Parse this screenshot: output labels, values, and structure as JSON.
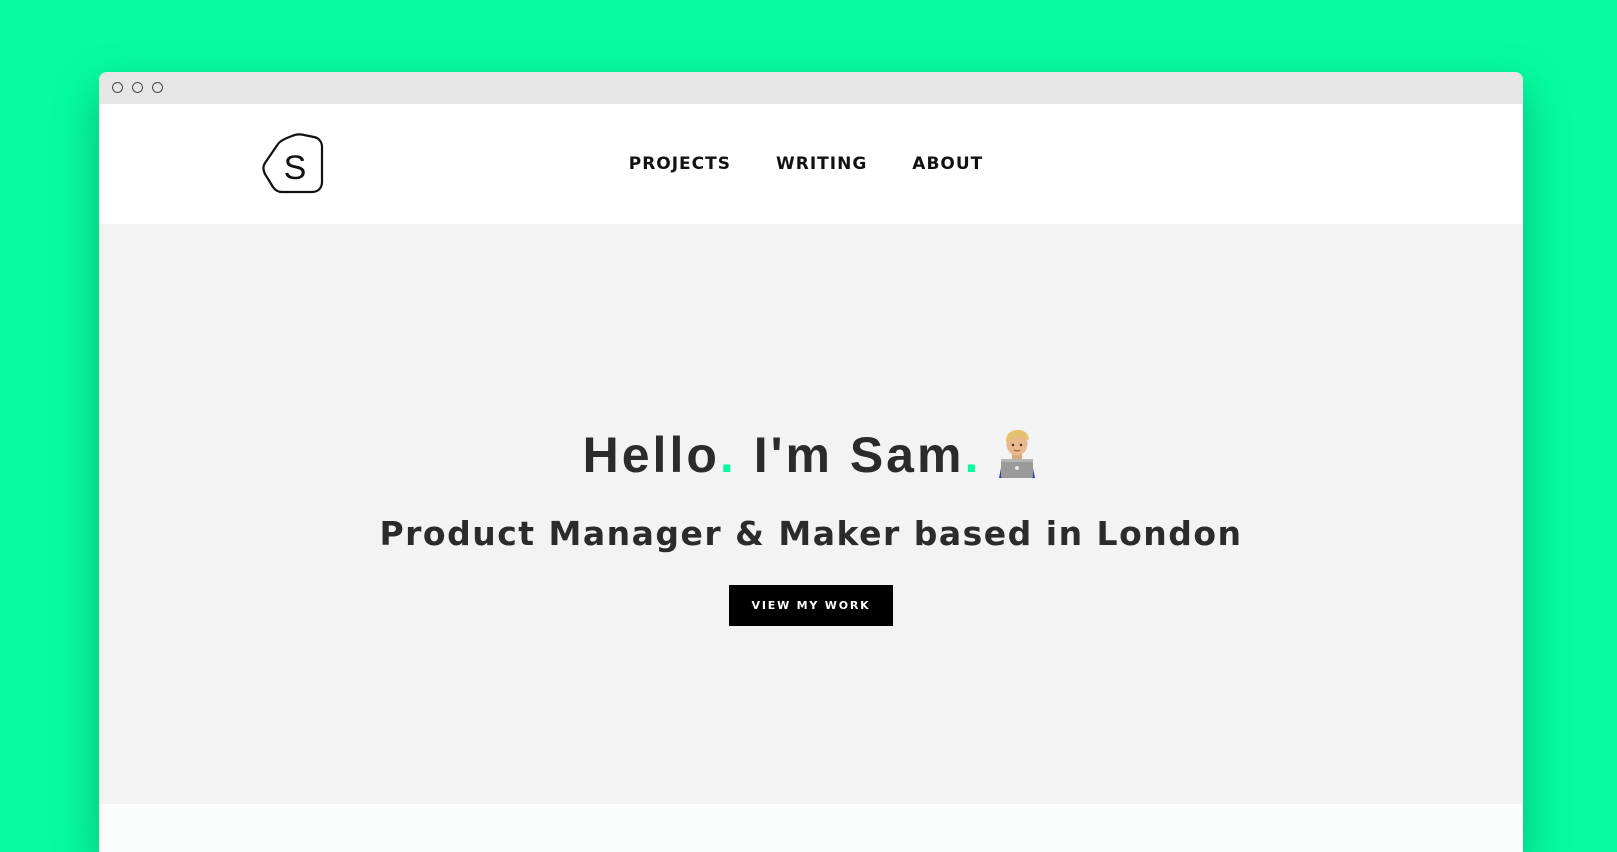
{
  "colors": {
    "background": "#06fca0",
    "accent": "#06fca0",
    "hero_bg": "#f3f3f3",
    "text": "#2b2b2b",
    "button_bg": "#000000"
  },
  "logo": {
    "letter": "S",
    "icon": "rounded-pentagon-logo"
  },
  "nav": {
    "items": [
      {
        "label": "PROJECTS"
      },
      {
        "label": "WRITING"
      },
      {
        "label": "ABOUT"
      }
    ]
  },
  "hero": {
    "greeting": "Hello",
    "name_text": "I'm Sam",
    "period": ".",
    "emoji": "technologist-emoji",
    "subtitle": "Product Manager & Maker based in London",
    "cta_label": "VIEW MY WORK"
  }
}
